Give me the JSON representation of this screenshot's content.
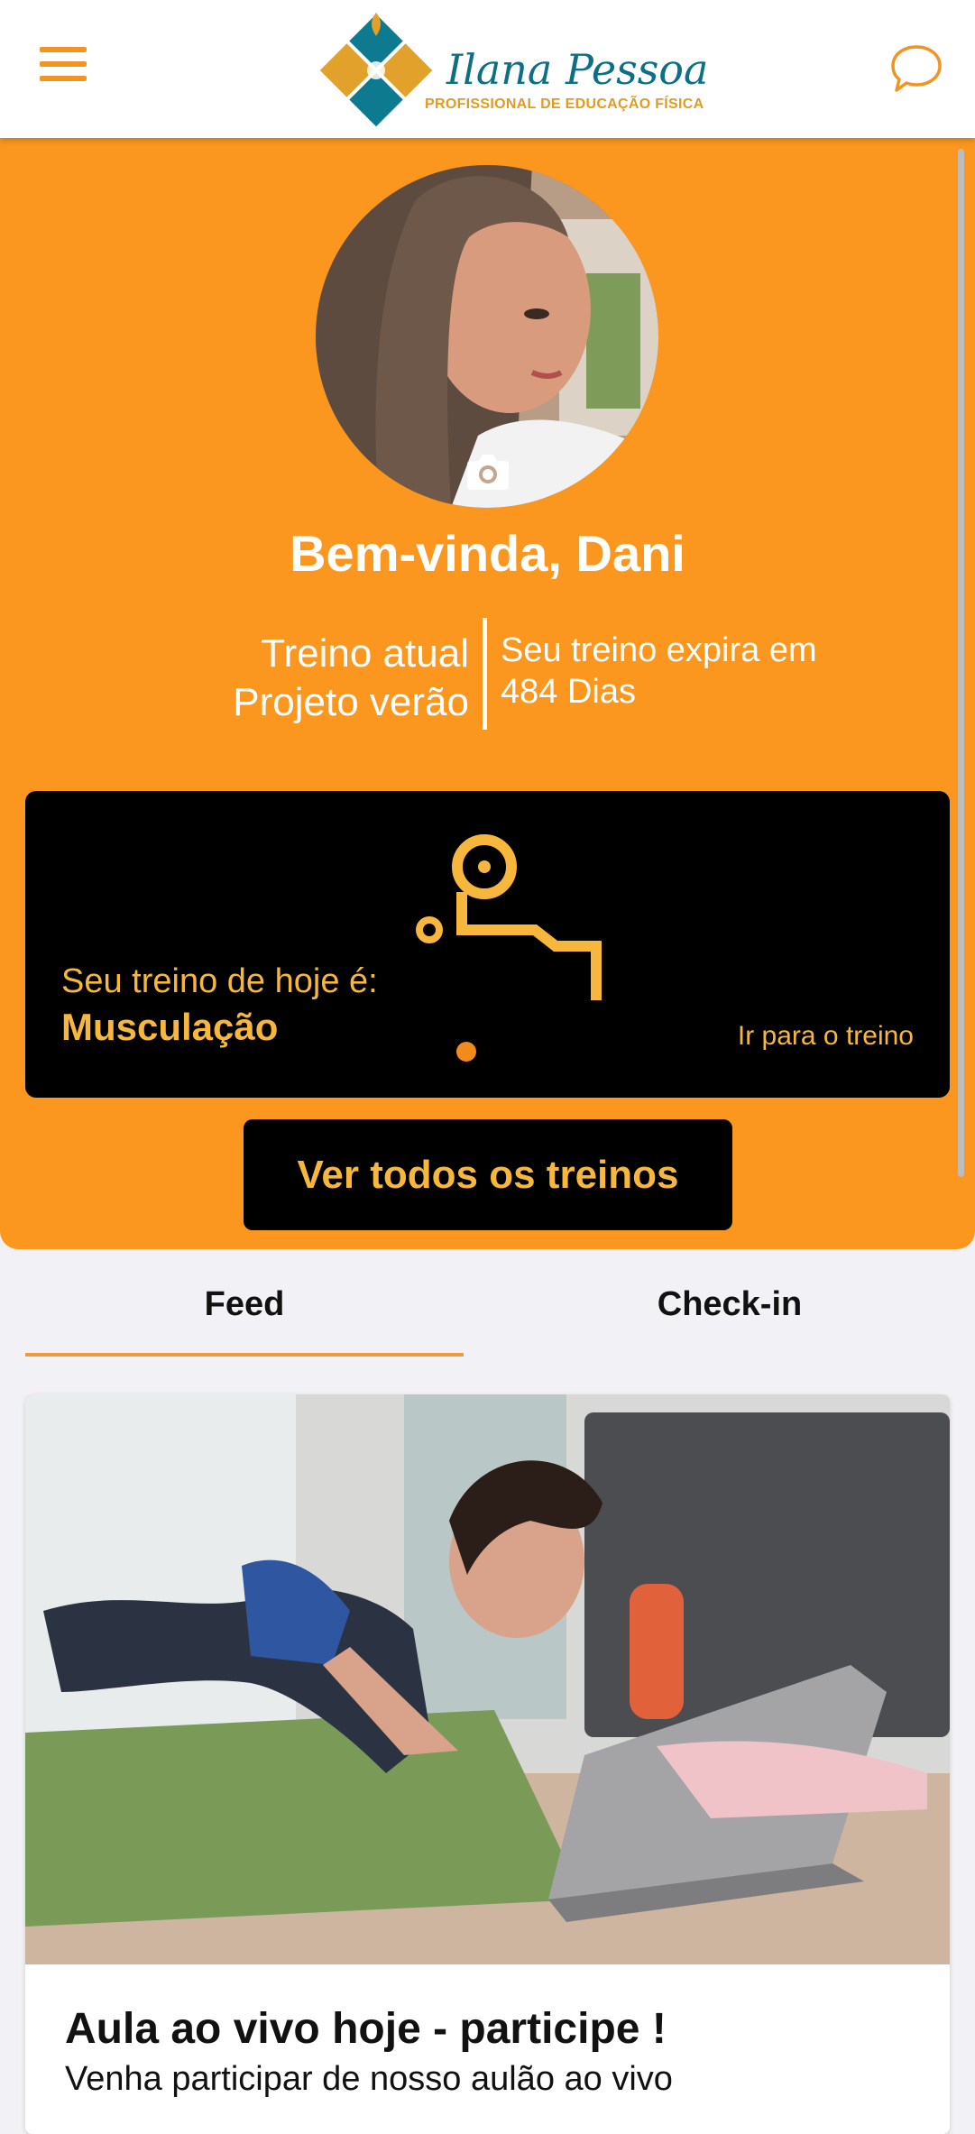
{
  "header": {
    "brand_name": "Ilana Pessoa",
    "brand_subtitle": "PROFISSIONAL DE EDUCAÇÃO FÍSICA",
    "menu_icon": "hamburger-menu-icon",
    "chat_icon": "chat-bubble-icon"
  },
  "profile": {
    "welcome": "Bem-vinda, Dani",
    "current_workout_label": "Treino atual",
    "current_workout_name": "Projeto verão",
    "expires_label": "Seu treino expira em",
    "expires_value": "484 Dias",
    "camera_icon": "camera-icon"
  },
  "today_workout": {
    "label": "Seu treino de hoje é:",
    "name": "Musculação",
    "go_label": "Ir para o treino",
    "icon": "weight-bench-icon"
  },
  "all_workouts_button": "Ver todos os treinos",
  "tabs": [
    {
      "label": "Feed",
      "active": true
    },
    {
      "label": "Check-in",
      "active": false
    }
  ],
  "feed": [
    {
      "title": "Aula ao vivo hoje - participe !",
      "subtitle": "Venha participar de nosso aulão ao vivo"
    }
  ],
  "colors": {
    "primary_orange": "#fb961f",
    "accent_yellow": "#f6b73c",
    "logo_teal": "#0d6f86",
    "card_black": "#000000"
  }
}
